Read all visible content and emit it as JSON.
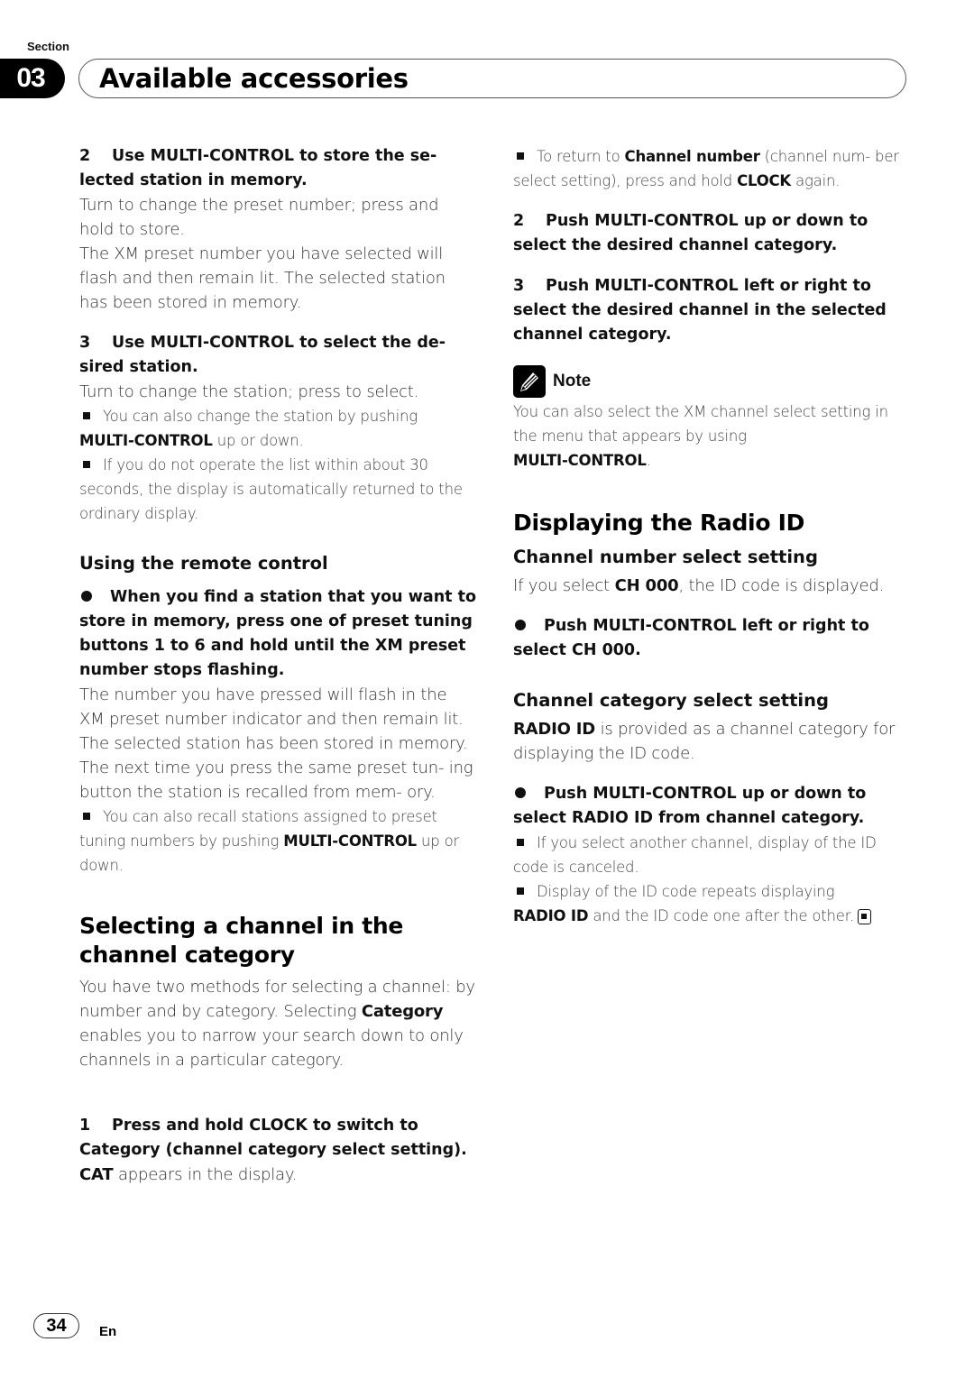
{
  "header": {
    "section_label": "Section",
    "section_number": "03",
    "title": "Available accessories"
  },
  "left_column": {
    "step2": {
      "number": "2",
      "heading": "Use MULTI-CONTROL to store the se- lected station in memory.",
      "text1": "Turn to change the preset number; press and hold to store.",
      "text2": "The XM preset number you have selected will flash and then remain lit. The selected station has been stored in memory."
    },
    "step3": {
      "number": "3",
      "heading": "Use MULTI-CONTROL to select the de- sired station.",
      "text": "Turn to change the station; press to select.",
      "bullet1_pre": "You can also change the station by pushing",
      "bullet1_bold": "MULTI-CONTROL",
      "bullet1_post": " up or down.",
      "bullet2": "If you do not operate the list within about 30 seconds, the display is automatically returned to the ordinary display."
    },
    "remote": {
      "heading": "Using the remote control",
      "instruction": "When you find a station that you want to store in memory, press one of preset tuning buttons 1 to 6 and hold until the XM preset number stops flashing.",
      "text1": "The number you have pressed will flash in the XM preset number indicator and then remain lit. The selected station has been stored in memory.",
      "text2": "The next time you press the same preset tun- ing button the station is recalled from mem- ory.",
      "bullet_pre": "You can also recall stations assigned to preset tuning numbers by pushing ",
      "bullet_bold": "MULTI-CONTROL",
      "bullet_post": " up or down."
    },
    "selecting": {
      "heading": "Selecting a channel in the channel category",
      "text_pre": "You have two methods for selecting a channel: by number and by category. Selecting ",
      "text_bold": "Category",
      "text_post": " enables you to narrow your search down to only channels in a particular category."
    },
    "step1": {
      "number": "1",
      "heading": "Press and hold CLOCK to switch to Category (channel category select setting).",
      "text_bold": "CAT",
      "text_post": " appears in the display."
    }
  },
  "right_column": {
    "bullet_return": {
      "pre": "To return to ",
      "bold1": "Channel number",
      "mid": " (channel num- ber select setting), press and hold ",
      "bold2": "CLOCK",
      "post": " again."
    },
    "step2": {
      "number": "2",
      "heading": "Push MULTI-CONTROL up or down to select the desired channel category."
    },
    "step3": {
      "number": "3",
      "heading": "Push MULTI-CONTROL left or right to select the desired channel in the selected channel category."
    },
    "note": {
      "label": "Note",
      "icon": "pencil-icon",
      "text": "You can also select the XM channel select setting in the menu that appears by using",
      "bold": "MULTI-CONTROL",
      "post": "."
    },
    "radio_id": {
      "heading": "Displaying the Radio ID",
      "ch_number_heading": "Channel number select setting",
      "ch_number_pre": "If you select ",
      "ch_number_bold": "CH 000",
      "ch_number_post": ", the ID code is displayed.",
      "ch_number_instruction": "Push MULTI-CONTROL left or right to select CH 000.",
      "ch_category_heading": "Channel category select setting",
      "ch_category_bold": "RADIO ID",
      "ch_category_post": " is provided as a channel category for displaying the ID code.",
      "ch_category_instruction": "Push MULTI-CONTROL up or down to select RADIO ID from channel category.",
      "bullet1": "If you select another channel, display of the ID code is canceled.",
      "bullet2_pre": "Display of the ID code repeats displaying",
      "bullet2_bold": "RADIO ID",
      "bullet2_post": " and the ID code one after the other."
    }
  },
  "footer": {
    "page_number": "34",
    "language": "En"
  }
}
